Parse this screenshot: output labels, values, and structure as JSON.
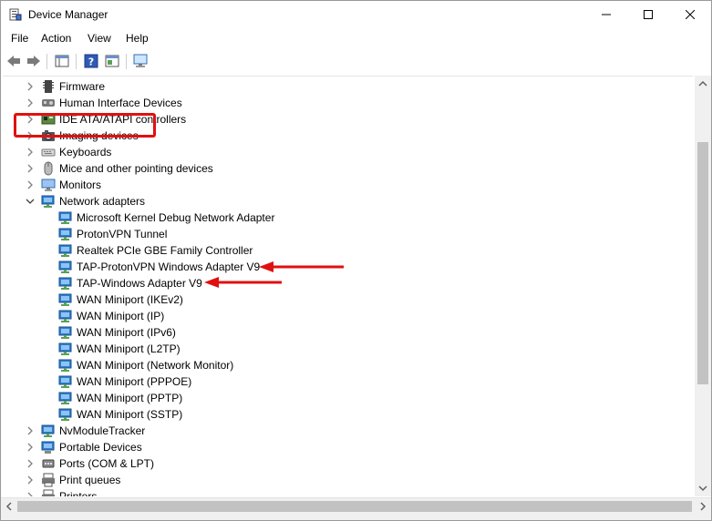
{
  "window": {
    "title": "Device Manager"
  },
  "menu": {
    "file": "File",
    "action": "Action",
    "view": "View",
    "help": "Help"
  },
  "tree": {
    "categories_top": [
      "Firmware",
      "Human Interface Devices",
      "IDE ATA/ATAPI controllers",
      "Imaging devices",
      "Keyboards",
      "Mice and other pointing devices",
      "Monitors"
    ],
    "network_adapters": {
      "label": "Network adapters",
      "expanded": true,
      "children": [
        "Microsoft Kernel Debug Network Adapter",
        "ProtonVPN Tunnel",
        "Realtek PCIe GBE Family Controller",
        "TAP-ProtonVPN Windows Adapter V9",
        "TAP-Windows Adapter V9",
        "WAN Miniport (IKEv2)",
        "WAN Miniport (IP)",
        "WAN Miniport (IPv6)",
        "WAN Miniport (L2TP)",
        "WAN Miniport (Network Monitor)",
        "WAN Miniport (PPPOE)",
        "WAN Miniport (PPTP)",
        "WAN Miniport (SSTP)"
      ]
    },
    "categories_bottom": [
      "NvModuleTracker",
      "Portable Devices",
      "Ports (COM & LPT)",
      "Print queues",
      "Printers"
    ]
  },
  "colors": {
    "highlight": "#e01010",
    "arrow": "#e01010",
    "network_icon": "#2f7fd0"
  }
}
